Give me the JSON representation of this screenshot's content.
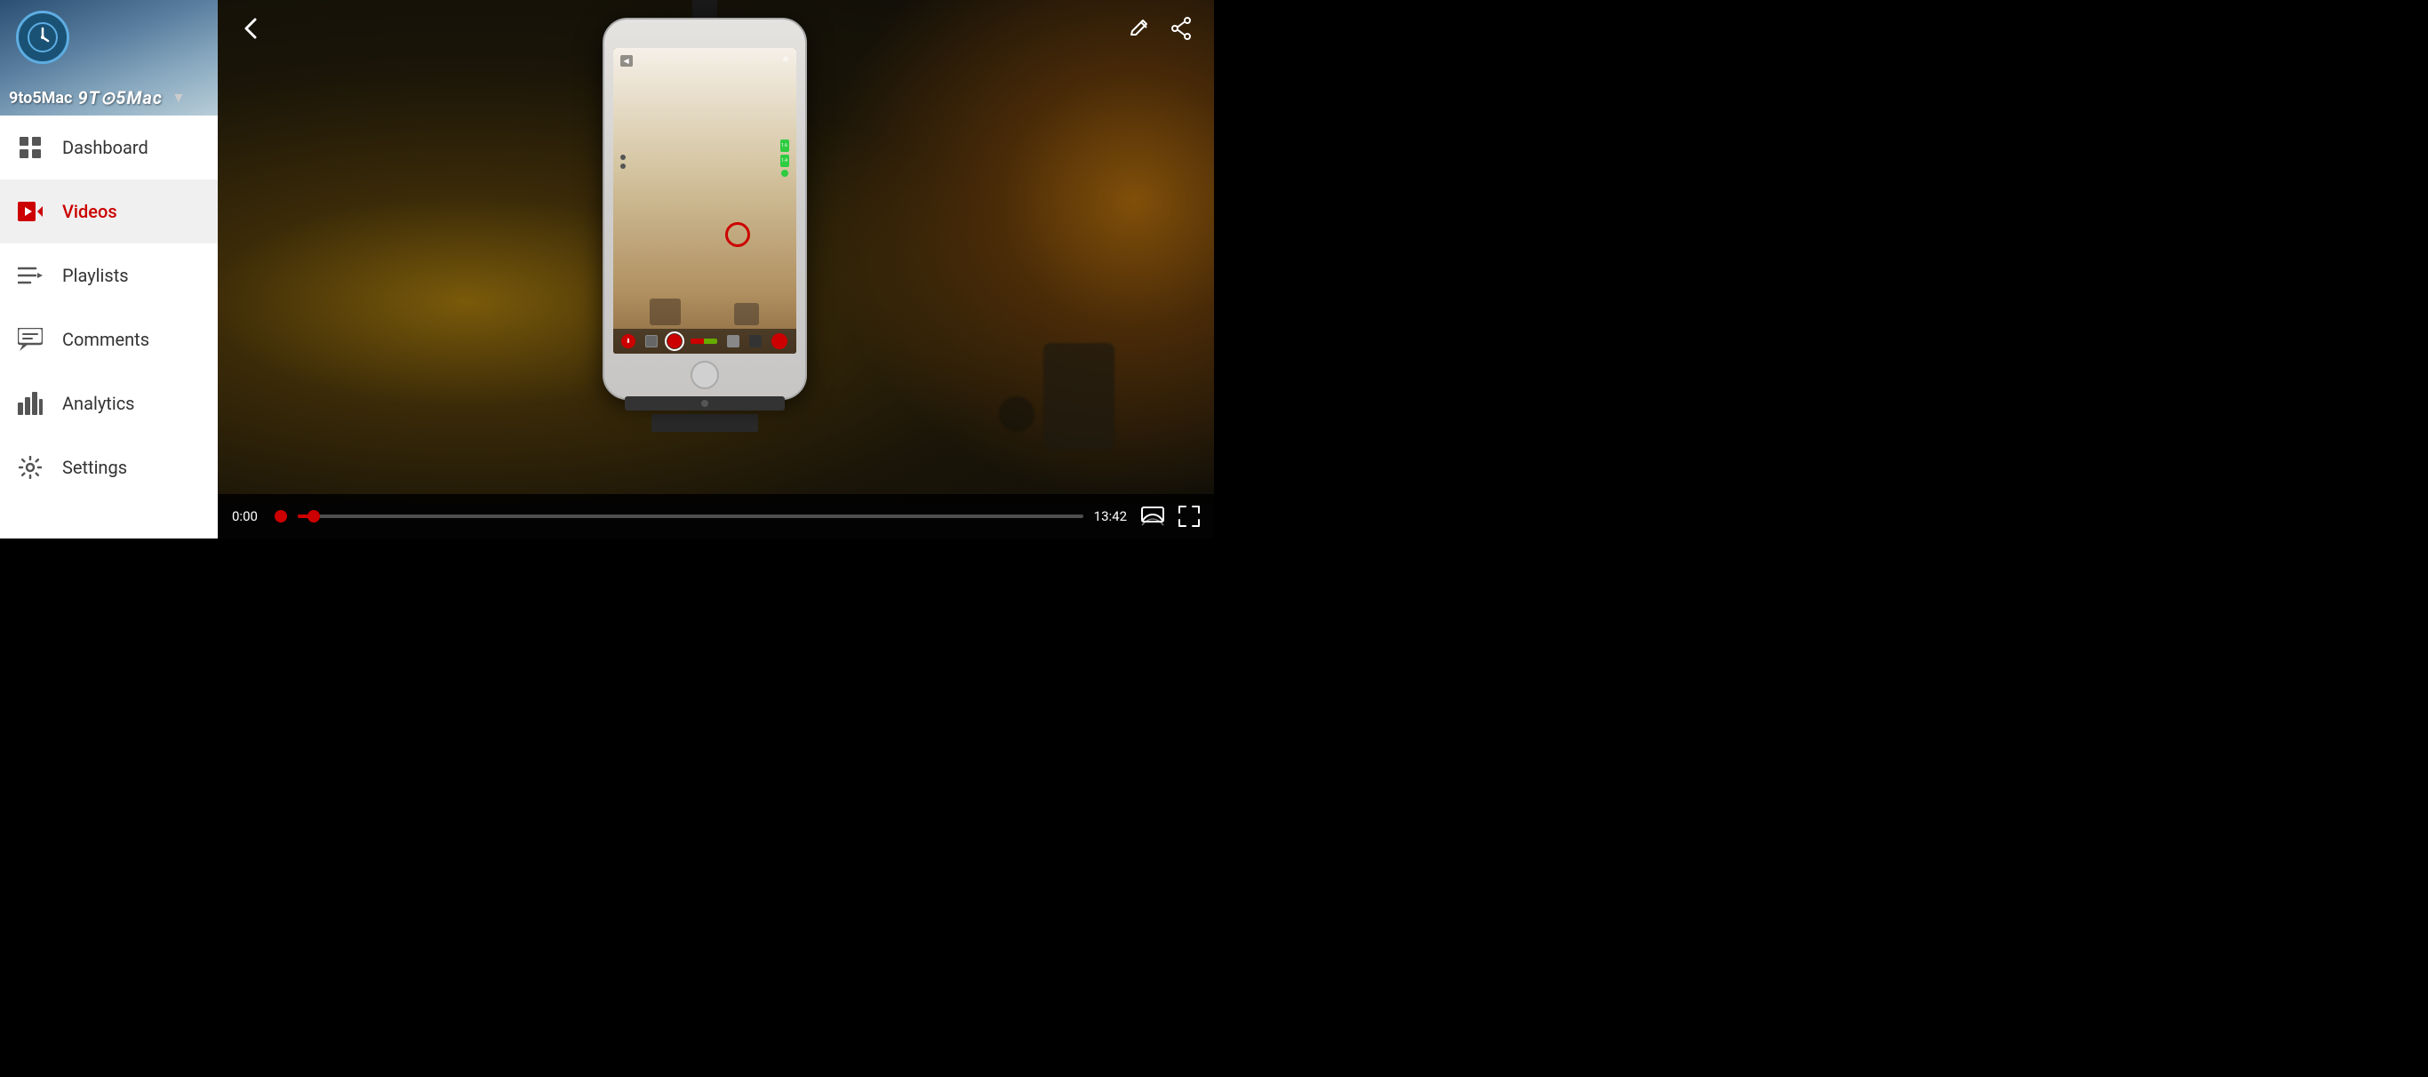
{
  "sidebar": {
    "channel": {
      "name": "9to5Mac",
      "name_display": "9TO5Mac",
      "chevron": "▼"
    },
    "nav_items": [
      {
        "id": "dashboard",
        "label": "Dashboard",
        "icon": "dashboard-icon",
        "active": false
      },
      {
        "id": "videos",
        "label": "Videos",
        "icon": "videos-icon",
        "active": true
      },
      {
        "id": "playlists",
        "label": "Playlists",
        "icon": "playlists-icon",
        "active": false
      },
      {
        "id": "comments",
        "label": "Comments",
        "icon": "comments-icon",
        "active": false
      },
      {
        "id": "analytics",
        "label": "Analytics",
        "icon": "analytics-icon",
        "active": false
      },
      {
        "id": "settings",
        "label": "Settings",
        "icon": "settings-icon",
        "active": false
      }
    ]
  },
  "video": {
    "current_time": "0:00",
    "total_time": "13:42",
    "progress_percent": 0
  },
  "icons": {
    "back": "←",
    "edit": "✏",
    "share": "↗",
    "cast": "⬜",
    "fullscreen": "⛶"
  }
}
